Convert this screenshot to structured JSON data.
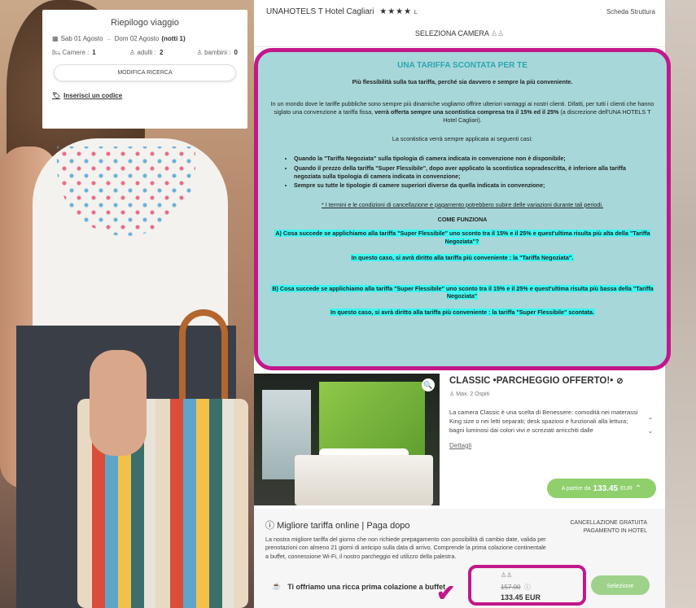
{
  "summary": {
    "title": "Riepilogo viaggio",
    "checkin": "Sab 01 Agosto",
    "checkout": "Dom 02 Agosto",
    "nights": "(notti 1)",
    "rooms_label": "Camere :",
    "rooms_value": "1",
    "adults_label": "adulti :",
    "adults_value": "2",
    "children_label": "bambini :",
    "children_value": "0",
    "modify_button": "MODIFICA RICERCA",
    "code_link": "Inserisci un codice"
  },
  "hotel": {
    "name": "UNAHOTELS T Hotel Cagliari",
    "stars": "★★★★",
    "star_suffix": "L",
    "scheda_link": "Scheda Struttura",
    "select_room": "SELEZIONA CAMERA"
  },
  "discount": {
    "title": "UNA TARIFFA SCONTATA PER TE",
    "subtitle": "Più flessibilità sulla tua tariffa, perché sia davvero e sempre la più conveniente.",
    "intro_a": "In un mondo dove le tariffe pubbliche sono sempre più dinamiche vogliamo offrire ulteriori vantaggi ai nostri clienti. Difatti, per tutti i clienti che hanno siglato una convenzione a tariffa fissa, ",
    "intro_b": "verrà offerta sempre una scontistica compresa tra il 15% ed il 25%",
    "intro_c": " (a discrezione dell'UNA HOTELS T Hotel Cagliari).",
    "cases_intro": "La scontistica verrà sempre applicata ai seguenti casi:",
    "cases": [
      "Quando la \"Tariffa Negoziata\" sulla tipologia di camera indicata in convenzione non è disponibile;",
      "Quando il prezzo della tariffa \"Super Flessibile\", dopo aver applicato la scontistica sopradescritta, è inferiore alla tariffa negoziata sulla tipologia di camera indicata in convenzione;",
      "Sempre su tutte le tipologie di camere superiori diverse da quella indicata in convenzione;"
    ],
    "note": "* I termini e le condizioni di cancellazione e pagamento potrebbero subire delle variazioni durante tali periodi.",
    "how_title": "COME FUNZIONA",
    "qa_a": "A) Cosa succede se applichiamo alla tariffa \"Super Flessibile\" uno sconto tra il 15% e il 25% e quest'ultima risulta più alta della \"Tariffa Negoziata\"?",
    "ans_a": "In questo caso, si avrà diritto alla tariffa più conveniente : la \"Tariffa Negoziata\".",
    "qa_b": "B) Cosa succede se applichiamo alla tariffa \"Super Flessibile\" uno sconto tra il 15% e il 25% e quest'ultima risulta più bassa della \"Tariffa Negoziata\"",
    "ans_b": "In questo caso, si avrà diritto alla tariffa più conveniente : la tariffa \"Super Flessibile\" scontata."
  },
  "room": {
    "title": "CLASSIC •PARCHEGGIO OFFERTO!•",
    "guests": "Max. 2 Ospiti",
    "description": "La camera Classic è una scelta di Benessere: comodità nei materassi King size o nei letti separati; desk spaziosi e funzionali alla lettura; bagni luminosi dai colori vivi e screziati arricchiti dalle",
    "details_link": "Dettagli",
    "price_prefix": "A partire da",
    "price_value": "133.45",
    "price_currency": "EUR"
  },
  "rate": {
    "title": "Migliore tariffa online | Paga dopo",
    "cancel_line1": "CANCELLAZIONE GRATUITA",
    "cancel_line2": "PAGAMENTO IN HOTEL",
    "description": "La nostra migliore tariffa del giorno che non richiede prepagamento con possibilità di cambio date, valida per prenotazioni con almeno 21 giorni di anticipo sulla data di arrivo. Comprende la prima colazione continentale a buffet, connessione Wi-Fi, il nostro parcheggio ed utilizzo della palestra.",
    "breakfast": "Ti offriamo una ricca prima colazione a buffet",
    "old_price": "157.00",
    "new_price": "133.45 EUR",
    "select_button": "Selezione"
  },
  "colors": {
    "accent_magenta": "#c2188a",
    "discount_bg": "#a8d7d9",
    "highlight_cyan": "#3df7f1",
    "green_button": "#8fcf6c"
  }
}
